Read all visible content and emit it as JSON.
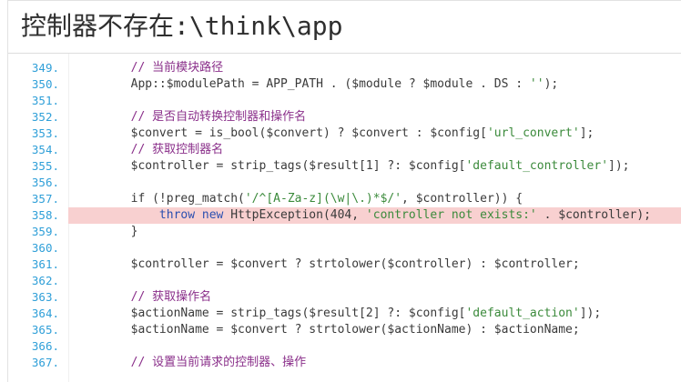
{
  "header": {
    "title": "控制器不存在:\\think\\app"
  },
  "code": {
    "highlight_line": "358.",
    "lines": [
      {
        "num": "349.",
        "indent": "        ",
        "parts": [
          {
            "t": "// 当前模块路径",
            "c": "cmt"
          }
        ]
      },
      {
        "num": "350.",
        "indent": "        ",
        "parts": [
          {
            "t": "App::$modulePath = APP_PATH . ($module ? $module . DS : ",
            "c": "pln"
          },
          {
            "t": "''",
            "c": "str"
          },
          {
            "t": ");",
            "c": "pln"
          }
        ]
      },
      {
        "num": "351.",
        "indent": "",
        "parts": []
      },
      {
        "num": "352.",
        "indent": "        ",
        "parts": [
          {
            "t": "// 是否自动转换控制器和操作名",
            "c": "cmt"
          }
        ]
      },
      {
        "num": "353.",
        "indent": "        ",
        "parts": [
          {
            "t": "$convert = is_bool($convert) ? $convert : $config[",
            "c": "pln"
          },
          {
            "t": "'url_convert'",
            "c": "str"
          },
          {
            "t": "];",
            "c": "pln"
          }
        ]
      },
      {
        "num": "354.",
        "indent": "        ",
        "parts": [
          {
            "t": "// 获取控制器名",
            "c": "cmt"
          }
        ]
      },
      {
        "num": "355.",
        "indent": "        ",
        "parts": [
          {
            "t": "$controller = strip_tags($result[1] ?: $config[",
            "c": "pln"
          },
          {
            "t": "'default_controller'",
            "c": "str"
          },
          {
            "t": "]);",
            "c": "pln"
          }
        ]
      },
      {
        "num": "356.",
        "indent": "",
        "parts": []
      },
      {
        "num": "357.",
        "indent": "        ",
        "parts": [
          {
            "t": "if (!preg_match(",
            "c": "pln"
          },
          {
            "t": "'/^[A-Za-z](\\w|\\.)*$/'",
            "c": "str"
          },
          {
            "t": ", $controller)) {",
            "c": "pln"
          }
        ]
      },
      {
        "num": "358.",
        "indent": "            ",
        "parts": [
          {
            "t": "throw new ",
            "c": "kw"
          },
          {
            "t": "HttpException(404, ",
            "c": "pln"
          },
          {
            "t": "'controller not exists:'",
            "c": "str"
          },
          {
            "t": " . $controller);",
            "c": "pln"
          }
        ]
      },
      {
        "num": "359.",
        "indent": "        ",
        "parts": [
          {
            "t": "}",
            "c": "pln"
          }
        ]
      },
      {
        "num": "360.",
        "indent": "",
        "parts": []
      },
      {
        "num": "361.",
        "indent": "        ",
        "parts": [
          {
            "t": "$controller = $convert ? strtolower($controller) : $controller;",
            "c": "pln"
          }
        ]
      },
      {
        "num": "362.",
        "indent": "",
        "parts": []
      },
      {
        "num": "363.",
        "indent": "        ",
        "parts": [
          {
            "t": "// 获取操作名",
            "c": "cmt"
          }
        ]
      },
      {
        "num": "364.",
        "indent": "        ",
        "parts": [
          {
            "t": "$actionName = strip_tags($result[2] ?: $config[",
            "c": "pln"
          },
          {
            "t": "'default_action'",
            "c": "str"
          },
          {
            "t": "]);",
            "c": "pln"
          }
        ]
      },
      {
        "num": "365.",
        "indent": "        ",
        "parts": [
          {
            "t": "$actionName = $convert ? strtolower($actionName) : $actionName;",
            "c": "pln"
          }
        ]
      },
      {
        "num": "366.",
        "indent": "",
        "parts": []
      },
      {
        "num": "367.",
        "indent": "        ",
        "parts": [
          {
            "t": "// 设置当前请求的控制器、操作",
            "c": "cmt"
          }
        ]
      }
    ]
  }
}
